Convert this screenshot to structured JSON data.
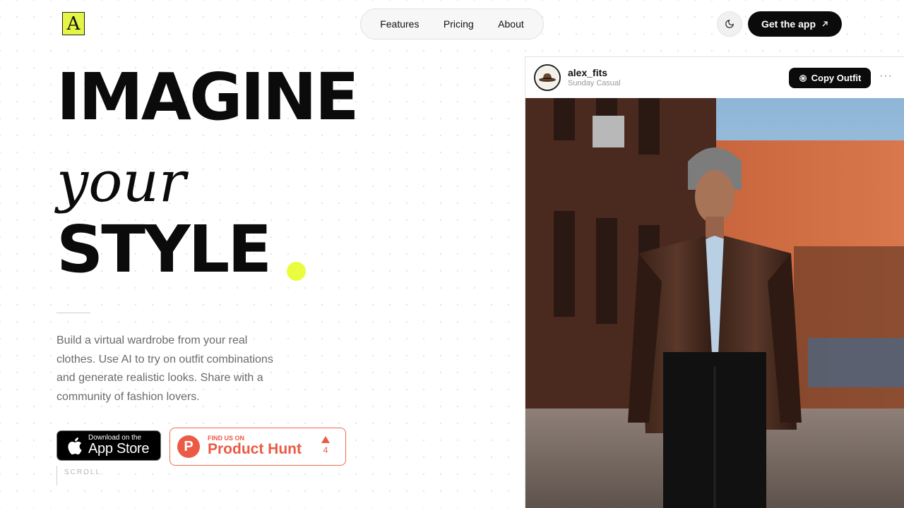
{
  "brand": {
    "logo_letter": "A"
  },
  "nav": {
    "items": [
      {
        "label": "Features"
      },
      {
        "label": "Pricing"
      },
      {
        "label": "About"
      }
    ]
  },
  "header": {
    "theme_icon": "moon-icon",
    "cta_label": "Get the app",
    "cta_icon": "arrow-up-right-icon"
  },
  "hero": {
    "line1": "IMAGINE",
    "line2": "your",
    "line3": "STYLE",
    "accent_color": "#eafc3e",
    "description": "Build a virtual wardrobe from your real clothes. Use AI to try on outfit combinations and generate realistic looks. Share with a community of fashion lovers."
  },
  "badges": {
    "appstore": {
      "small": "Download on the",
      "big": "App Store"
    },
    "producthunt": {
      "small": "FIND US ON",
      "big": "Product Hunt",
      "votes": "4",
      "color": "#ec5a45"
    }
  },
  "scroll": {
    "label": "SCROLL"
  },
  "post": {
    "username": "alex_fits",
    "subtitle": "Sunday Casual",
    "copy_label": "Copy Outfit",
    "copy_icon": "hanger-icon",
    "more_icon": "more-icon"
  }
}
